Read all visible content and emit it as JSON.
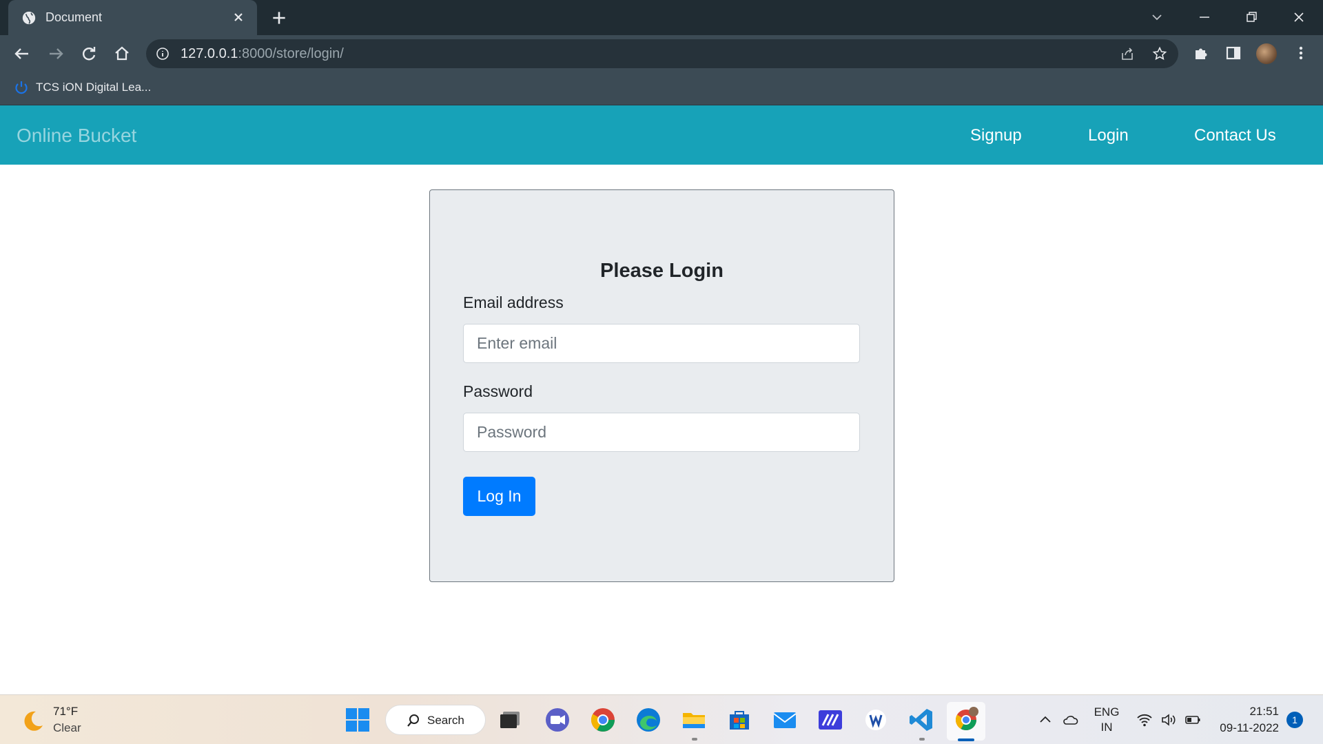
{
  "browser": {
    "tab": {
      "title": "Document"
    },
    "address": {
      "host": "127.0.0.1",
      "path": ":8000/store/login/"
    },
    "bookmarks": [
      {
        "label": "TCS iON Digital Lea..."
      }
    ]
  },
  "site": {
    "brand": "Online Bucket",
    "nav": {
      "signup": "Signup",
      "login": "Login",
      "contact": "Contact Us"
    },
    "colors": {
      "navbar": "#17a2b8",
      "primary_button": "#007bff",
      "card": "#e9ecef"
    }
  },
  "login_form": {
    "title": "Please Login",
    "email": {
      "label": "Email address",
      "placeholder": "Enter email",
      "value": ""
    },
    "password": {
      "label": "Password",
      "placeholder": "Password",
      "value": ""
    },
    "submit": "Log In"
  },
  "taskbar": {
    "weather": {
      "temp": "71°F",
      "desc": "Clear"
    },
    "search": "Search",
    "lang": {
      "line1": "ENG",
      "line2": "IN"
    },
    "clock": {
      "time": "21:51",
      "date": "09-11-2022"
    },
    "notifications": "1",
    "apps": [
      "start-icon",
      "search",
      "task-view-icon",
      "teams-chat-icon",
      "chrome-icon",
      "edge-icon",
      "file-explorer-icon",
      "store-icon",
      "mail-icon",
      "pen-app-icon",
      "word-app-icon",
      "vscode-icon",
      "chrome-profile-icon"
    ]
  }
}
